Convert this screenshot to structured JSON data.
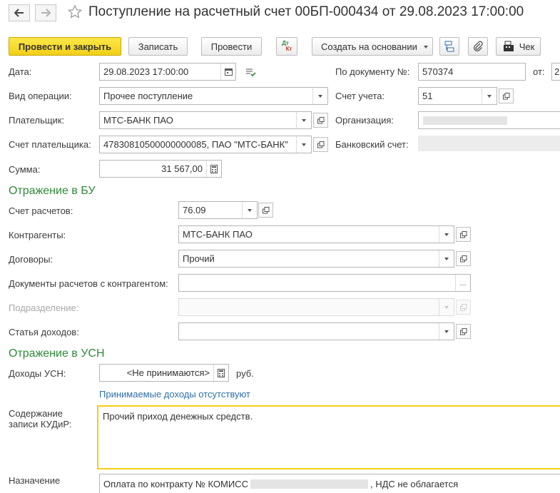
{
  "window": {
    "title": "Поступление на расчетный счет 00БП-000434 от 29.08.2023 17:00:00",
    "icons": {
      "back": "arrow-left-icon",
      "forward": "arrow-right-icon",
      "favorite": "star-icon"
    }
  },
  "toolbar": {
    "post_and_close": "Провести и закрыть",
    "save": "Записать",
    "post": "Провести",
    "dtkt_dt": "Дт",
    "dtkt_kt": "Кт",
    "create_based_on": "Создать на основании",
    "receipt": "Чек",
    "colors": {
      "primary": "#f2cf16"
    }
  },
  "header": {
    "date_label": "Дата:",
    "date_value": "29.08.2023 17:00:00",
    "doc_number_label": "По документу №:",
    "doc_number_value": "570374",
    "doc_date_label": "от:",
    "doc_date_value": "2",
    "operation_type_label": "Вид операции:",
    "operation_type_value": "Прочее поступление",
    "account_label": "Счет учета:",
    "account_value": "51",
    "payer_label": "Плательщик:",
    "payer_value": "МТС-БАНК ПАО",
    "organization_label": "Организация:",
    "payer_account_label": "Счет плательщика:",
    "payer_account_value": "47830810500000000085, ПАО \"МТС-БАНК\"",
    "bank_account_label": "Банковский счет:",
    "amount_label": "Сумма:",
    "amount_value": "31 567,00"
  },
  "bu": {
    "section_title": "Отражение в БУ",
    "settlement_account_label": "Счет расчетов:",
    "settlement_account_value": "76.09",
    "counterparties_label": "Контрагенты:",
    "counterparties_value": "МТС-БАНК ПАО",
    "contracts_label": "Договоры:",
    "contracts_value": "Прочий",
    "settlement_docs_label": "Документы расчетов с контрагентом:",
    "settlement_docs_value": "",
    "department_label": "Подразделение:",
    "department_value": "",
    "income_item_label": "Статья доходов:",
    "income_item_value": ""
  },
  "usn": {
    "section_title": "Отражение в УСН",
    "income_label": "Доходы УСН:",
    "income_value": "<Не принимаются>",
    "currency": "руб.",
    "info_link": "Принимаемые доходы отсутствуют",
    "kudir_label_line1": "Содержание",
    "kudir_label_line2": "записи КУДиР:",
    "kudir_value": "Прочий приход денежных средств."
  },
  "purpose": {
    "label": "Назначение",
    "value_part1": "Оплата по контракту № КОМИСС",
    "value_part2": ", НДС не облагается"
  }
}
